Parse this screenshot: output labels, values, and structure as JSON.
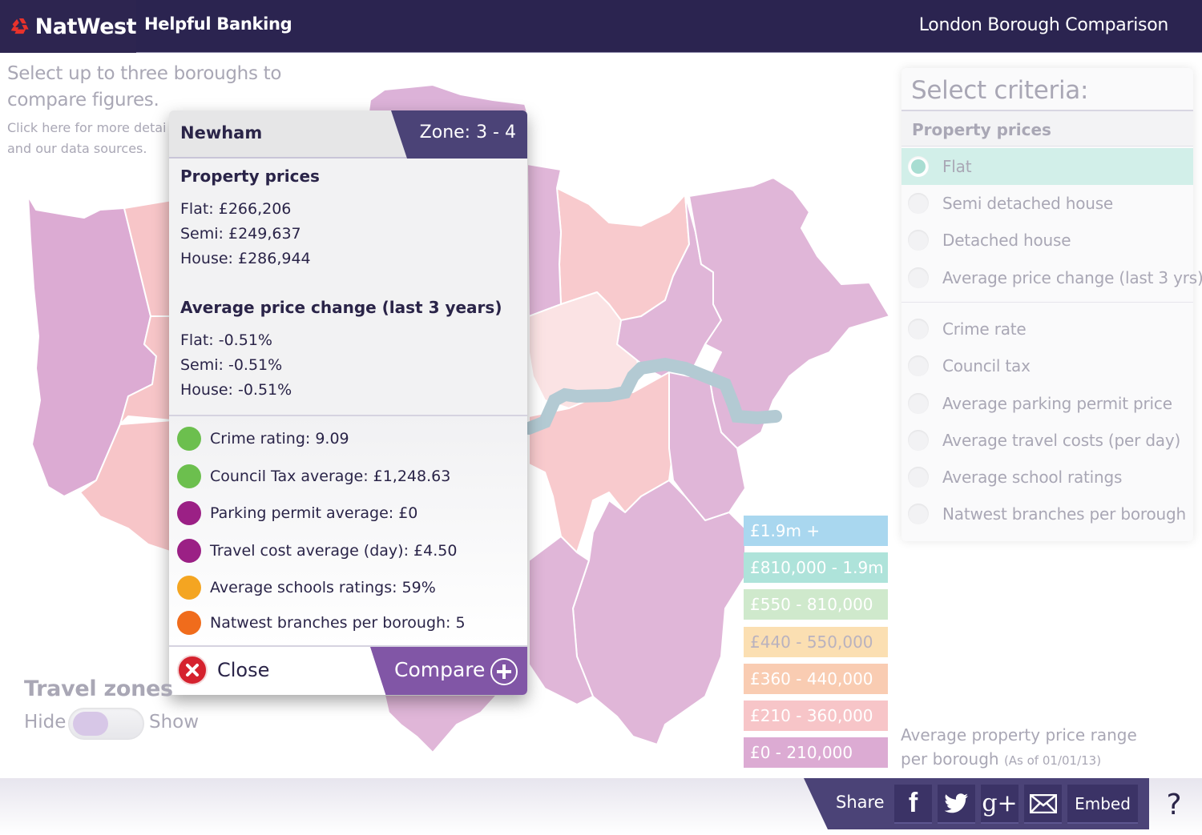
{
  "header": {
    "brand": "NatWest",
    "tagline": "Helpful Banking",
    "title": "London Borough Comparison"
  },
  "intro": {
    "text": "Select up to three boroughs to compare figures.",
    "link_line1": "Click here for more details",
    "link_line2": "and our data sources."
  },
  "popup": {
    "borough": "Newham",
    "zone": "Zone: 3 - 4",
    "property_title": "Property prices",
    "property_lines": [
      "Flat: £266,206",
      "Semi: £249,637",
      "House: £286,944"
    ],
    "change_title": "Average price change (last 3 years)",
    "change_lines": [
      "Flat: -0.51%",
      "Semi: -0.51%",
      "House: -0.51%"
    ],
    "stats": [
      {
        "text": "Crime rating: 9.09",
        "color": "#6cbf4e"
      },
      {
        "text": "Council Tax average: £1,248.63",
        "color": "#6cbf4e"
      },
      {
        "text": "Parking permit average: £0",
        "color": "#9b2085"
      },
      {
        "text": "Travel cost average (day): £4.50",
        "color": "#9b2085"
      },
      {
        "text": "Average schools ratings: 59%",
        "color": "#f4a521"
      },
      {
        "text": "Natwest branches per borough: 5",
        "color": "#f06c1c"
      }
    ],
    "close_label": "Close",
    "compare_label": "Compare"
  },
  "criteria": {
    "title": "Select criteria:",
    "group_label": "Property prices",
    "property_options": [
      {
        "label": "Flat",
        "selected": true
      },
      {
        "label": "Semi detached house",
        "selected": false
      },
      {
        "label": "Detached house",
        "selected": false
      },
      {
        "label": "Average price change (last 3 yrs)",
        "selected": false
      }
    ],
    "other_options": [
      {
        "label": "Crime rate",
        "selected": false
      },
      {
        "label": "Council tax",
        "selected": false
      },
      {
        "label": "Average parking permit price",
        "selected": false
      },
      {
        "label": "Average travel costs (per day)",
        "selected": false
      },
      {
        "label": "Average school ratings",
        "selected": false
      },
      {
        "label": "Natwest branches per borough",
        "selected": false
      }
    ]
  },
  "legend": {
    "items": [
      {
        "label": "£1.9m +",
        "color": "#a9d7ef"
      },
      {
        "label": "£810,000 - 1.9m",
        "color": "#aee3da"
      },
      {
        "label": "£550 - 810,000",
        "color": "#cfe9cc"
      },
      {
        "label": "£440 - 550,000",
        "color": "#fbdfb2",
        "text_color": "#b9b2bf"
      },
      {
        "label": "£360 - 440,000",
        "color": "#f9ccb2"
      },
      {
        "label": "£210 - 360,000",
        "color": "#f7c5c8"
      },
      {
        "label": "£0 - 210,000",
        "color": "#dcabd3"
      }
    ],
    "caption_line1": "Average property price range",
    "caption_line2": "per borough",
    "caption_note": "(As of 01/01/13)"
  },
  "travel_zones": {
    "title": "Travel zones",
    "hide_label": "Hide",
    "show_label": "Show",
    "state": "hide"
  },
  "footer": {
    "share_label": "Share",
    "buttons": [
      {
        "name": "facebook",
        "label": "f"
      },
      {
        "name": "twitter",
        "label": ""
      },
      {
        "name": "google-plus",
        "label": "g+"
      },
      {
        "name": "email",
        "label": ""
      },
      {
        "name": "embed",
        "label": "Embed"
      }
    ],
    "help_label": "?"
  },
  "map": {
    "colors": {
      "low": "#dcabd3",
      "mid": "#f7c5c8",
      "light": "#fbe3e4",
      "river": "#b3cad3"
    }
  }
}
